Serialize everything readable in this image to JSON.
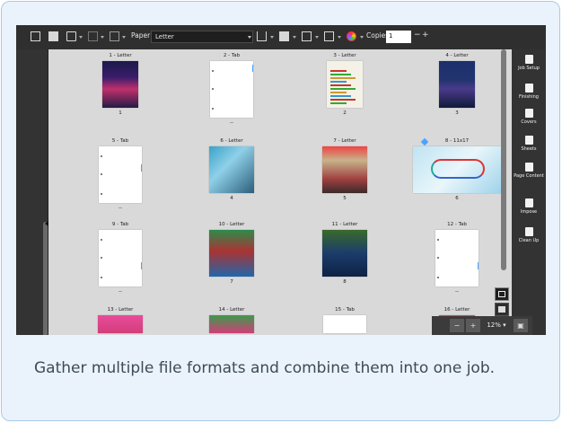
{
  "toolbar": {
    "paper_label": "Paper:",
    "paper_value": "Letter",
    "copies_label": "Copies:",
    "copies_value": "1",
    "minus": "−",
    "plus": "+"
  },
  "pages": [
    {
      "label": "1 - Letter",
      "num": "1"
    },
    {
      "label": "2 - Tab",
      "num": "--"
    },
    {
      "label": "3 - Letter",
      "num": "2"
    },
    {
      "label": "4 - Letter",
      "num": "3"
    },
    {
      "label": "5 - Tab",
      "num": "--"
    },
    {
      "label": "6 - Letter",
      "num": "4"
    },
    {
      "label": "7 - Letter",
      "num": "5"
    },
    {
      "label": "8 - 11x17",
      "num": "6"
    },
    {
      "label": "9 - Tab",
      "num": "--"
    },
    {
      "label": "10 - Letter",
      "num": "7"
    },
    {
      "label": "11 - Letter",
      "num": "8"
    },
    {
      "label": "12 - Tab",
      "num": "--"
    },
    {
      "label": "13 - Letter",
      "num": ""
    },
    {
      "label": "14 - Letter",
      "num": ""
    },
    {
      "label": "15 - Tab",
      "num": ""
    },
    {
      "label": "16 - Letter",
      "num": ""
    }
  ],
  "right_panel": [
    {
      "label": "Job Setup",
      "icon": "job-setup-icon"
    },
    {
      "label": "Finishing",
      "icon": "finishing-icon"
    },
    {
      "label": "Covers",
      "icon": "covers-icon"
    },
    {
      "label": "Sheets",
      "icon": "sheets-icon"
    },
    {
      "label": "Page Content",
      "icon": "page-content-icon"
    },
    {
      "label": "Impose",
      "icon": "impose-icon"
    },
    {
      "label": "Clean Up",
      "icon": "clean-up-icon"
    }
  ],
  "zoom": {
    "value": "12%"
  },
  "caption": "Gather multiple file formats and combine them into one job."
}
